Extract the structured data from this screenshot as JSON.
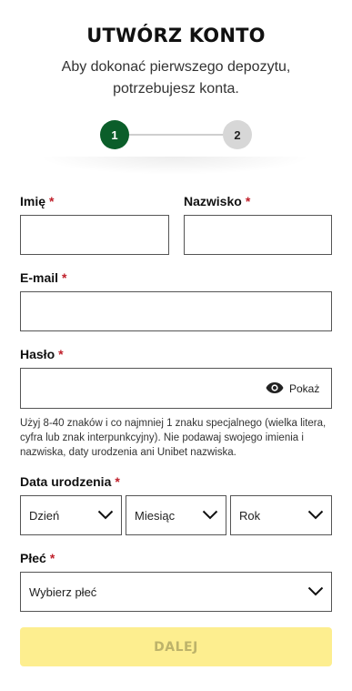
{
  "header": {
    "title": "UTWÓRZ KONTO",
    "subtitle_line1": "Aby dokonać pierwszego depozytu,",
    "subtitle_line2": "potrzebujesz konta."
  },
  "stepper": {
    "current_step": 1,
    "steps": [
      "1",
      "2"
    ]
  },
  "required_mark": "*",
  "form": {
    "first_name": {
      "label": "Imię",
      "value": ""
    },
    "last_name": {
      "label": "Nazwisko",
      "value": ""
    },
    "email": {
      "label": "E-mail",
      "value": ""
    },
    "password": {
      "label": "Hasło",
      "value": "",
      "show_label": "Pokaż",
      "help": "Użyj 8-40 znaków i co najmniej 1 znaku specjalnego (wielka litera, cyfra lub znak interpunkcyjny). Nie podawaj swojego imienia i nazwiska, daty urodzenia ani Unibet nazwiska."
    },
    "birth_date": {
      "label": "Data urodzenia",
      "day": "Dzień",
      "month": "Miesiąc",
      "year": "Rok"
    },
    "gender": {
      "label": "Płeć",
      "placeholder": "Wybierz płeć"
    },
    "submit_label": "DALEJ"
  },
  "colors": {
    "step_active": "#0b5e2a",
    "step_inactive": "#d7d7d7",
    "required": "#c0202b",
    "submit_bg": "#fdee8f"
  }
}
